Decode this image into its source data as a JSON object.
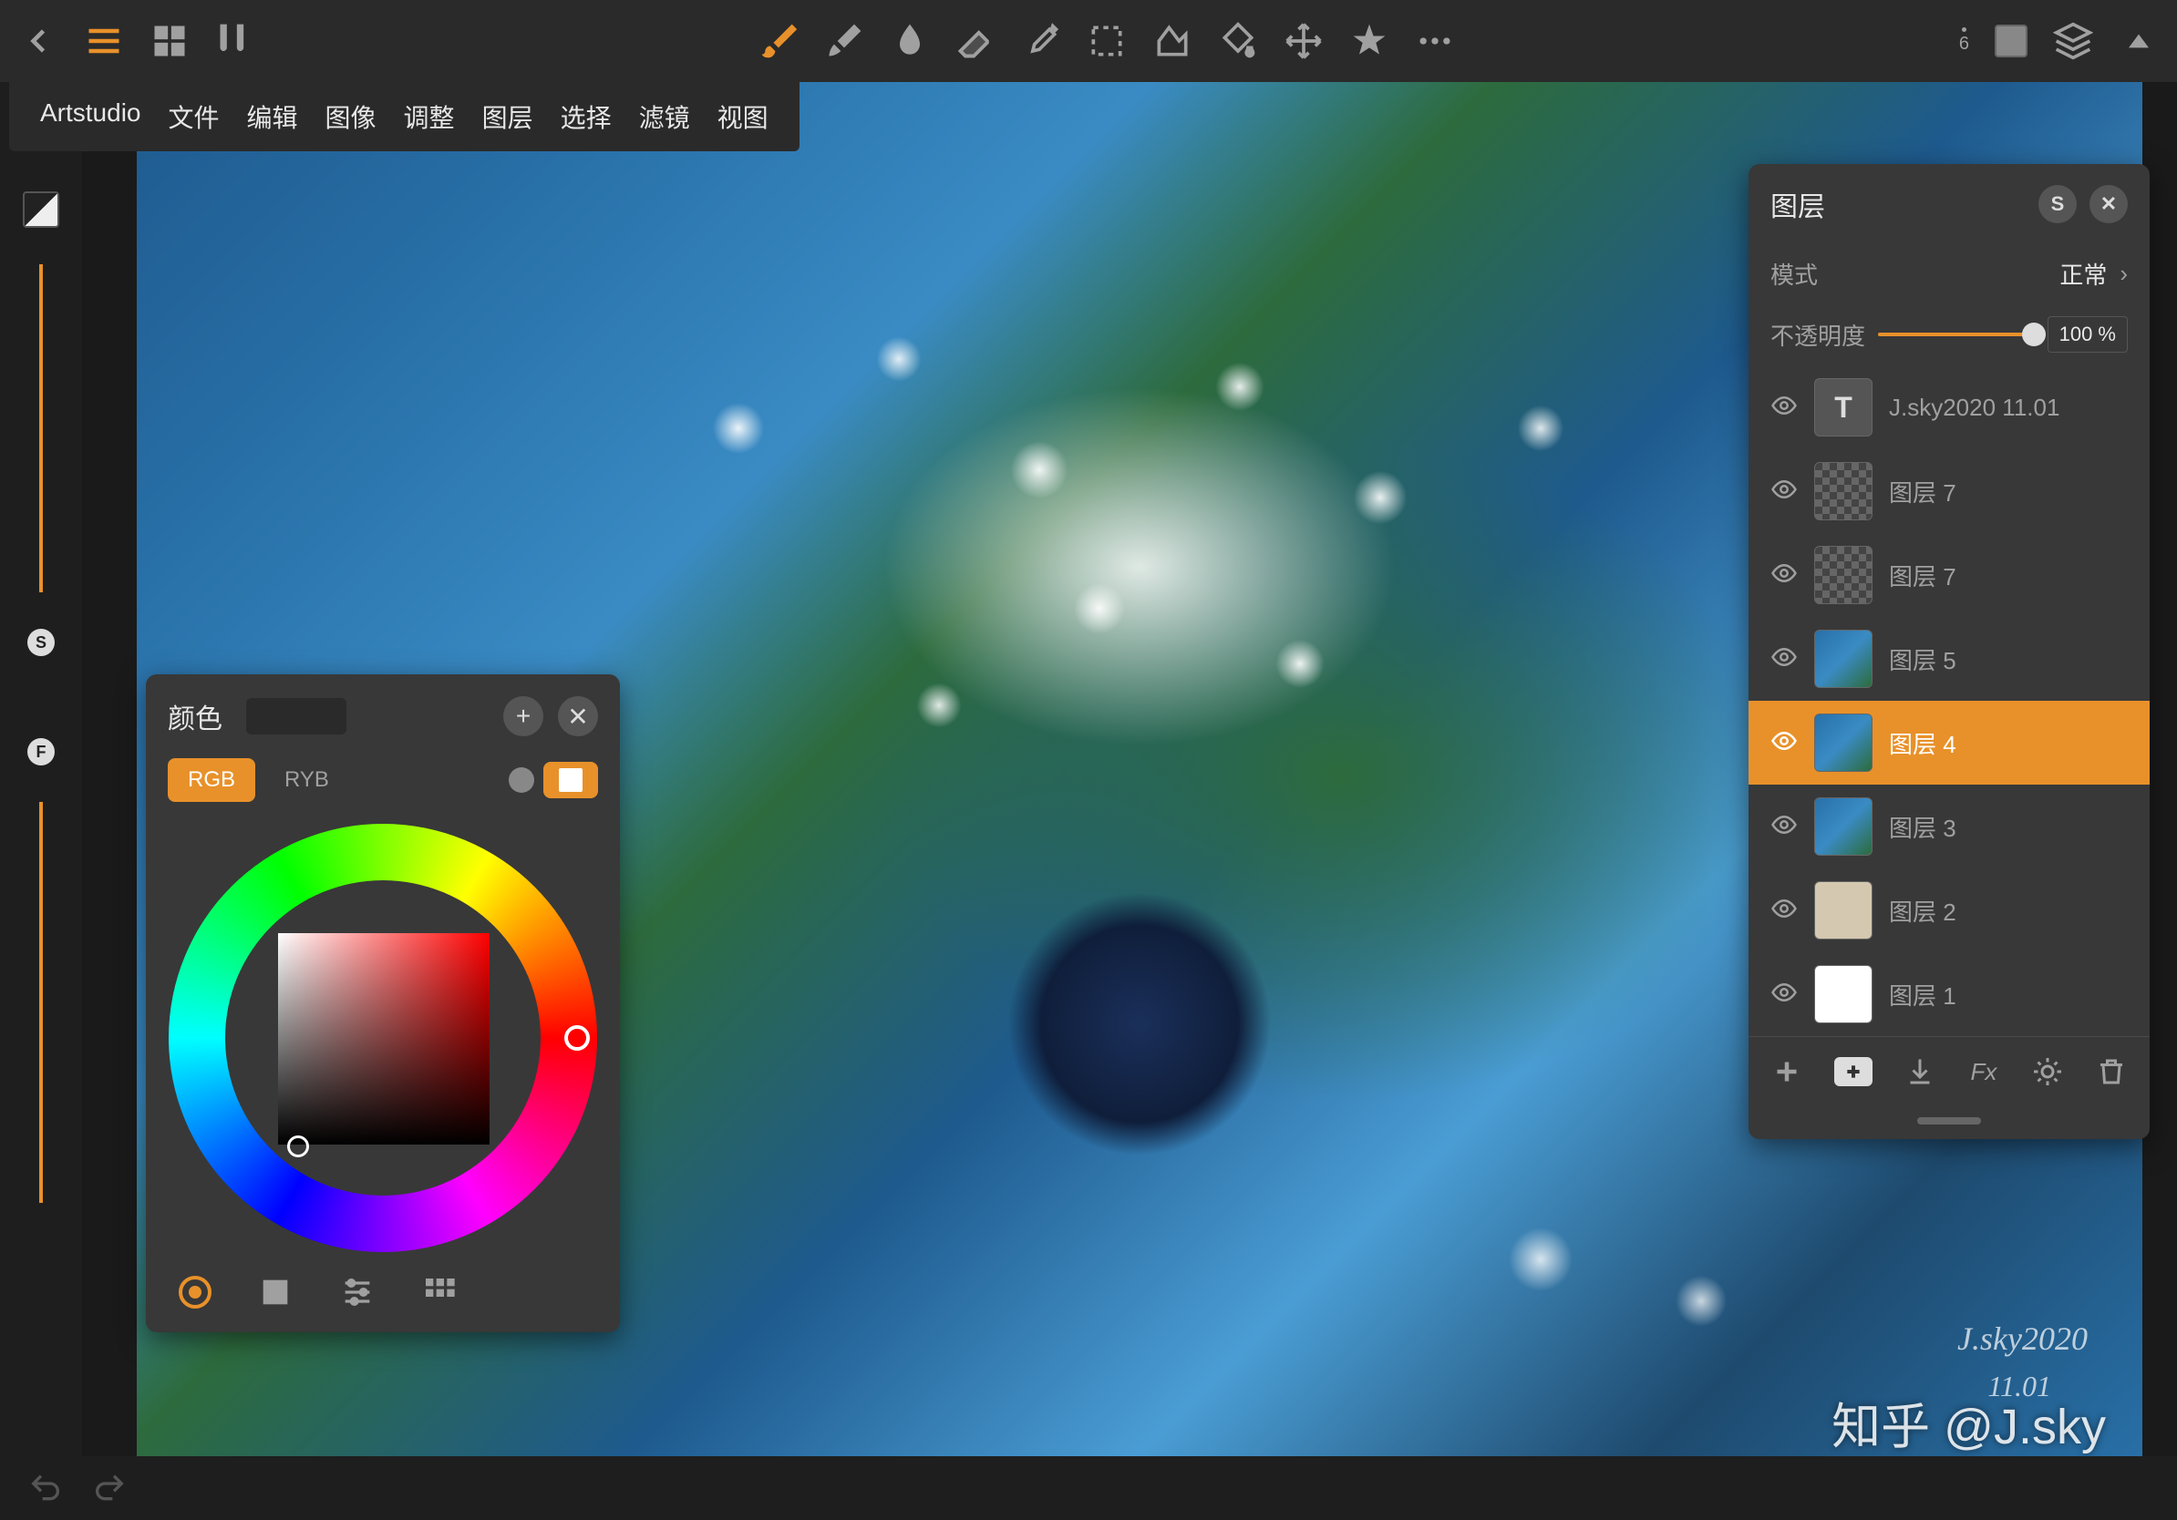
{
  "menu": {
    "items": [
      "Artstudio",
      "文件",
      "编辑",
      "图像",
      "调整",
      "图层",
      "选择",
      "滤镜",
      "视图"
    ]
  },
  "toolbar": {
    "brush_count": "6"
  },
  "left_sidebar": {
    "badge_s": "S",
    "badge_f": "F"
  },
  "color_panel": {
    "title": "颜色",
    "mode_rgb": "RGB",
    "mode_ryb": "RYB"
  },
  "layers_panel": {
    "title": "图层",
    "s_badge": "S",
    "mode_label": "模式",
    "mode_value": "正常",
    "opacity_label": "不透明度",
    "opacity_value": "100 %",
    "fx_label": "Fx",
    "layers": [
      {
        "name": "J.sky2020 11.01",
        "thumb_type": "text",
        "thumb_text": "T"
      },
      {
        "name": "图层 7",
        "thumb_type": "checker"
      },
      {
        "name": "图层 7",
        "thumb_type": "checker"
      },
      {
        "name": "图层 5",
        "thumb_type": "painting"
      },
      {
        "name": "图层 4",
        "thumb_type": "painting",
        "selected": true
      },
      {
        "name": "图层 3",
        "thumb_type": "painting"
      },
      {
        "name": "图层 2",
        "thumb_type": "tan"
      },
      {
        "name": "图层 1",
        "thumb_type": "white"
      }
    ]
  },
  "canvas": {
    "signature": "J.sky2020",
    "signature_date": "11.01",
    "watermark": "知乎 @J.sky"
  }
}
